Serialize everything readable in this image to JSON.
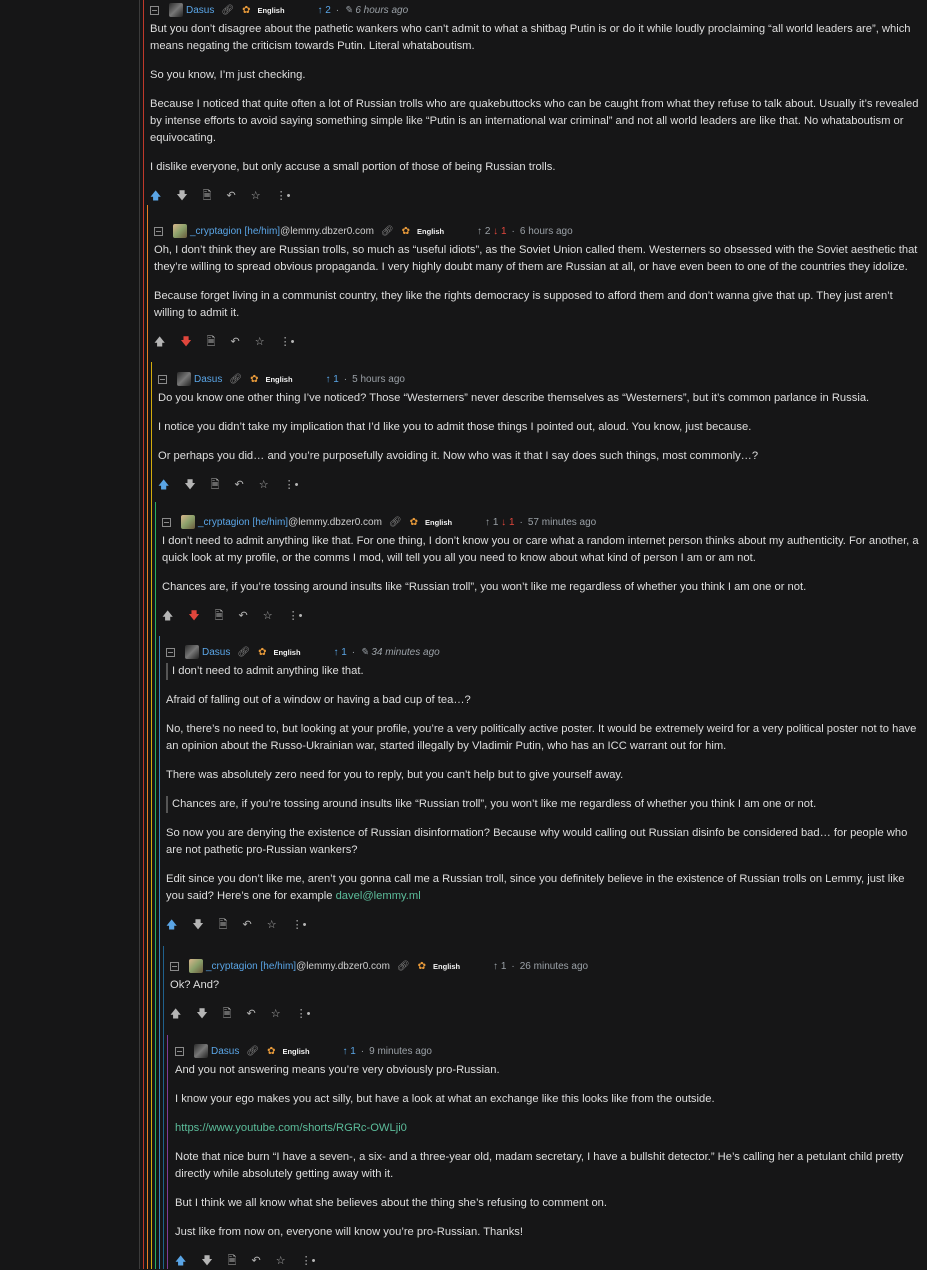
{
  "colors": {
    "upvote": "#5aa5e6",
    "downvote": "#e0463c",
    "link": "#5cbd9b",
    "background": "#161617",
    "text": "#dedede"
  },
  "icons": {
    "collapse": "collapse-icon",
    "permalink": "link-icon",
    "badge": "flower-icon",
    "upvote": "arrow-up-icon",
    "downvote": "arrow-down-icon",
    "source": "document-icon",
    "reply": "reply-icon",
    "save": "star-icon",
    "more": "more-icon"
  },
  "comments": [
    {
      "user": "Dasus",
      "instance": "",
      "lang": "English",
      "up": "↑ 2",
      "down": "",
      "edited": true,
      "time": "6 hours ago",
      "my_vote": "up",
      "paras": [
        "But you don’t disagree about the pathetic wankers who can’t admit to what a shitbag Putin is or do it while loudly proclaiming “all world leaders are”, which means negating the criticism towards Putin. Literal whataboutism.",
        "So you know, I’m just checking.",
        "Because I noticed that quite often a lot of Russian trolls who are quakebuttocks who can be caught from what they refuse to talk about. Usually it’s revealed by intense efforts to avoid saying something simple like “Putin is an international war criminal” and not all world leaders are like that. No whataboutism or equivocating.",
        "I dislike everyone, but only accuse a small portion of those of being Russian trolls."
      ]
    },
    {
      "user": "_cryptagion [he/him]",
      "instance": "@lemmy.dbzer0.com",
      "lang": "English",
      "up": "↑ 2",
      "down": "↓ 1",
      "edited": false,
      "time": "6 hours ago",
      "my_vote": "down",
      "paras": [
        "Oh, I don’t think they are Russian trolls, so much as “useful idiots”, as the Soviet Union called them. Westerners so obsessed with the Soviet aesthetic that they’re willing to spread obvious propaganda. I very highly doubt many of them are Russian at all, or have even been to one of the countries they idolize.",
        "Because forget living in a communist country, they like the rights democracy is supposed to afford them and don’t wanna give that up. They just aren’t willing to admit it."
      ]
    },
    {
      "user": "Dasus",
      "instance": "",
      "lang": "English",
      "up": "↑ 1",
      "down": "",
      "edited": false,
      "time": "5 hours ago",
      "my_vote": "up",
      "paras": [
        "Do you know one other thing I’ve noticed? Those “Westerners” never describe themselves as “Westerners”, but it’s common parlance in Russia.",
        "I notice you didn’t take my implication that I’d like you to admit those things I pointed out, aloud. You know, just because.",
        "Or perhaps you did… and you’re purposefully avoiding it. Now who was it that I say does such things, most commonly…?"
      ]
    },
    {
      "user": "_cryptagion [he/him]",
      "instance": "@lemmy.dbzer0.com",
      "lang": "English",
      "up": "↑ 1",
      "down": "↓ 1",
      "edited": false,
      "time": "57 minutes ago",
      "my_vote": "down",
      "paras": [
        "I don’t need to admit anything like that. For one thing, I don’t know you or care what a random internet person thinks about my authenticity. For another, a quick look at my profile, or the comms I mod, will tell you all you need to know about what kind of person I am or am not.",
        "Chances are, if you’re tossing around insults like “Russian troll”, you won’t like me regardless of whether you think I am one or not."
      ]
    },
    {
      "user": "Dasus",
      "instance": "",
      "lang": "English",
      "up": "↑ 1",
      "down": "",
      "edited": true,
      "time": "34 minutes ago",
      "my_vote": "up",
      "quote1": "I don’t need to admit anything like that.",
      "p1": "Afraid of falling out of a window or having a bad cup of tea…?",
      "p2": "No, there’s no need to, but looking at your profile, you’re a very politically active poster. It would be extremely weird for a very political poster not to have an opinion about the Russo-Ukrainian war, started illegally by Vladimir Putin, who has an ICC warrant out for him.",
      "p3": "There was absolutely zero need for you to reply, but you can’t help but to give yourself away.",
      "quote2": "Chances are, if you’re tossing around insults like “Russian troll”, you won’t like me regardless of whether you think I am one or not.",
      "p4": "So now you are denying the existence of Russian disinformation? Because why would calling out Russian disinfo be considered bad… for people who are not pathetic pro-Russian wankers?",
      "p5": "Edit since you don’t like me, aren’t you gonna call me a Russian troll, since you definitely believe in the existence of Russian trolls on Lemmy, just like you said? Here’s one for example",
      "p5_link": "davel@lemmy.ml"
    },
    {
      "user": "_cryptagion [he/him]",
      "instance": "@lemmy.dbzer0.com",
      "lang": "English",
      "up": "↑ 1",
      "down": "",
      "edited": false,
      "time": "26 minutes ago",
      "my_vote": "",
      "paras": [
        "Ok? And?"
      ]
    },
    {
      "user": "Dasus",
      "instance": "",
      "lang": "English",
      "up": "↑ 1",
      "down": "",
      "edited": false,
      "time": "9 minutes ago",
      "my_vote": "up",
      "p1": "And you not answering means you’re very obviously pro-Russian.",
      "p2": "I know your ego makes you act silly, but have a look at what an exchange like this looks like from the outside.",
      "link": "https://www.youtube.com/shorts/RGRc-OWLji0",
      "p3": "Note that nice burn “I have a seven-, a six- and a three-year old, madam secretary, I have a bullshit detector.” He’s calling her a petulant child pretty directly while absolutely getting away with it.",
      "p4": "But I think we all know what she believes about the thing she’s refusing to comment on.",
      "p5": "Just like from now on, everyone will know you’re pro-Russian. Thanks!"
    }
  ]
}
